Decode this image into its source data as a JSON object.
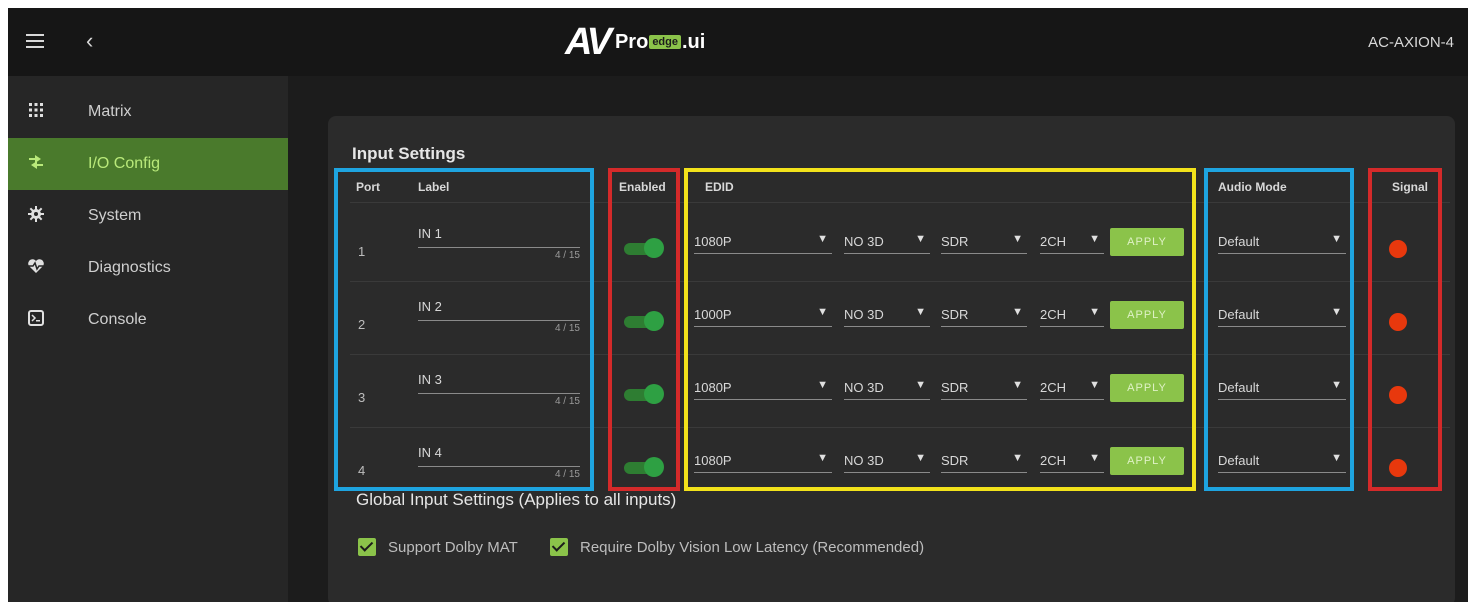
{
  "app": {
    "logo_av": "AV",
    "logo_pro": "Pro",
    "logo_edge": "edge",
    "logo_ui": ".ui",
    "device_name": "AC-AXION-4"
  },
  "sidebar": {
    "items": [
      {
        "label": "Matrix",
        "icon": "grid-icon",
        "active": false
      },
      {
        "label": "I/O Config",
        "icon": "swap-arrows-icon",
        "active": true
      },
      {
        "label": "System",
        "icon": "gear-icon",
        "active": false
      },
      {
        "label": "Diagnostics",
        "icon": "heartbeat-icon",
        "active": false
      },
      {
        "label": "Console",
        "icon": "terminal-icon",
        "active": false
      }
    ]
  },
  "input_settings": {
    "title": "Input Settings",
    "headers": {
      "port": "Port",
      "label": "Label",
      "enabled": "Enabled",
      "edid": "EDID",
      "audio_mode": "Audio Mode",
      "signal": "Signal"
    },
    "rows": [
      {
        "port": "1",
        "label": "IN 1",
        "count": "4 / 15",
        "enabled": true,
        "resolution": "1080P",
        "three_d": "NO 3D",
        "hdr": "SDR",
        "channels": "2CH",
        "apply": "APPLY",
        "audio_mode": "Default",
        "signal_color": "#e8380d"
      },
      {
        "port": "2",
        "label": "IN 2",
        "count": "4 / 15",
        "enabled": true,
        "resolution": "1000P",
        "three_d": "NO 3D",
        "hdr": "SDR",
        "channels": "2CH",
        "apply": "APPLY",
        "audio_mode": "Default",
        "signal_color": "#e8380d"
      },
      {
        "port": "3",
        "label": "IN 3",
        "count": "4 / 15",
        "enabled": true,
        "resolution": "1080P",
        "three_d": "NO 3D",
        "hdr": "SDR",
        "channels": "2CH",
        "apply": "APPLY",
        "audio_mode": "Default",
        "signal_color": "#e8380d"
      },
      {
        "port": "4",
        "label": "IN 4",
        "count": "4 / 15",
        "enabled": true,
        "resolution": "1080P",
        "three_d": "NO 3D",
        "hdr": "SDR",
        "channels": "2CH",
        "apply": "APPLY",
        "audio_mode": "Default",
        "signal_color": "#e8380d"
      }
    ]
  },
  "global_settings": {
    "title": "Global Input Settings (Applies to all inputs)",
    "options": [
      {
        "label": "Support Dolby MAT",
        "checked": true
      },
      {
        "label": "Require Dolby Vision Low Latency (Recommended)",
        "checked": true
      }
    ]
  },
  "colors": {
    "accent_green": "#8bc34a",
    "active_nav": "#4a7a2c",
    "highlight_blue": "#1ea4e0",
    "highlight_red": "#d42a2a",
    "highlight_yellow": "#f2e21b"
  }
}
